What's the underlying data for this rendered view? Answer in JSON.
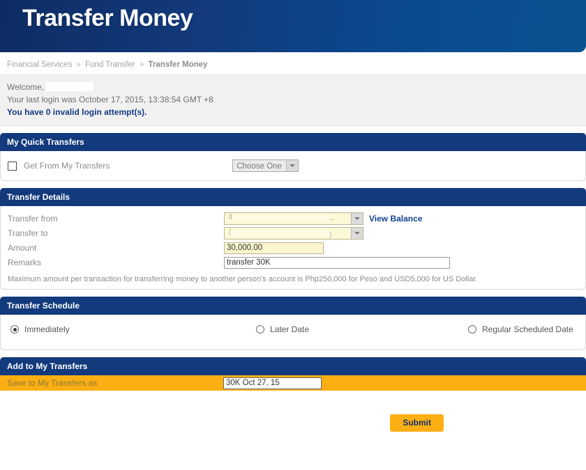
{
  "banner": {
    "title": "Transfer Money"
  },
  "breadcrumb": {
    "item1": "Financial Services",
    "sep1": "»",
    "item2": "Fund Transfer",
    "sep2": "»",
    "current": "Transfer Money"
  },
  "welcome": {
    "greeting": "Welcome,",
    "last_login": "Your last login was October 17, 2015, 13:38:54 GMT +8",
    "invalid_attempts": "You have 0 invalid login attempt(s)."
  },
  "quick_transfers": {
    "heading": "My Quick Transfers",
    "checkbox_label": "Get From My Transfers",
    "select_value": "Choose One",
    "select_checked": false
  },
  "transfer_details": {
    "heading": "Transfer Details",
    "transfer_from_label": "Transfer from",
    "transfer_from_value": "",
    "transfer_to_label": "Transfer to",
    "transfer_to_value": "",
    "view_balance_link": "View Balance",
    "amount_label": "Amount",
    "amount_value": "30,000.00",
    "remarks_label": "Remarks",
    "remarks_value": "transfer 30K",
    "note": "Maximum amount per transaction for transferring money to another person's account is Php250,000 for Peso and USD5,000 for US Dollar."
  },
  "transfer_schedule": {
    "heading": "Transfer Schedule",
    "options": [
      {
        "label": "Immediately",
        "selected": true
      },
      {
        "label": "Later Date",
        "selected": false
      },
      {
        "label": "Regular Scheduled Date",
        "selected": false
      }
    ]
  },
  "add_transfers": {
    "heading": "Add to My Transfers",
    "save_label": "Save to My Transfers as",
    "save_value": "30K Oct 27, 15"
  },
  "actions": {
    "submit_label": "Submit"
  },
  "colors": {
    "brand_navy": "#123a7d",
    "brand_blue_dark": "#0e2c63",
    "accent_orange": "#fcaf13",
    "link_blue": "#11418f",
    "field_yellow": "#faf6cf"
  }
}
